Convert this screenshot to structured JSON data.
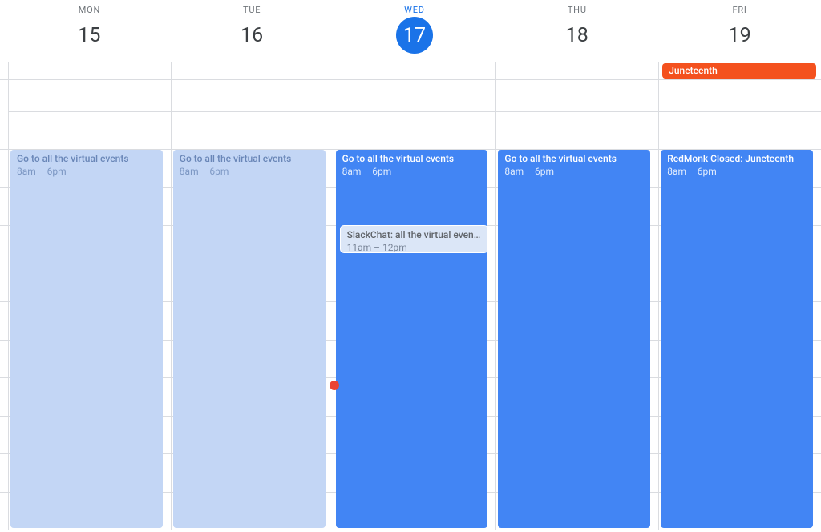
{
  "days": [
    {
      "dow": "MON",
      "num": "15",
      "today": false
    },
    {
      "dow": "TUE",
      "num": "16",
      "today": false
    },
    {
      "dow": "WED",
      "num": "17",
      "today": true
    },
    {
      "dow": "THU",
      "num": "18",
      "today": false
    },
    {
      "dow": "FRI",
      "num": "19",
      "today": false
    }
  ],
  "allday": {
    "fri": {
      "title": "Juneteenth",
      "color": "#f4511e"
    }
  },
  "grid": {
    "startHour": 7,
    "endHour": 18,
    "slotHeight": 47.45
  },
  "now": {
    "dayIndex": 2,
    "hour": 14,
    "minute": 10
  },
  "events": {
    "mon": {
      "title": "Go to all the virtual events",
      "time": "8am – 6pm",
      "startHour": 8,
      "endHour": 18,
      "style": "past"
    },
    "tue": {
      "title": "Go to all the virtual events",
      "time": "8am – 6pm",
      "startHour": 8,
      "endHour": 18,
      "style": "past"
    },
    "wed": {
      "title": "Go to all the virtual events",
      "time": "8am – 6pm",
      "startHour": 8,
      "endHour": 18,
      "style": "upcoming"
    },
    "wed_sub": {
      "title": "SlackChat: all the virtual events",
      "time": "11am – 12pm",
      "startHour": 10,
      "endHour": 10.75,
      "style": "nested"
    },
    "thu": {
      "title": "Go to all the virtual events",
      "time": "8am – 6pm",
      "startHour": 8,
      "endHour": 18,
      "style": "upcoming"
    },
    "fri": {
      "title": "RedMonk Closed: Juneteenth",
      "time": "8am – 6pm",
      "startHour": 8,
      "endHour": 18,
      "style": "upcoming"
    }
  }
}
